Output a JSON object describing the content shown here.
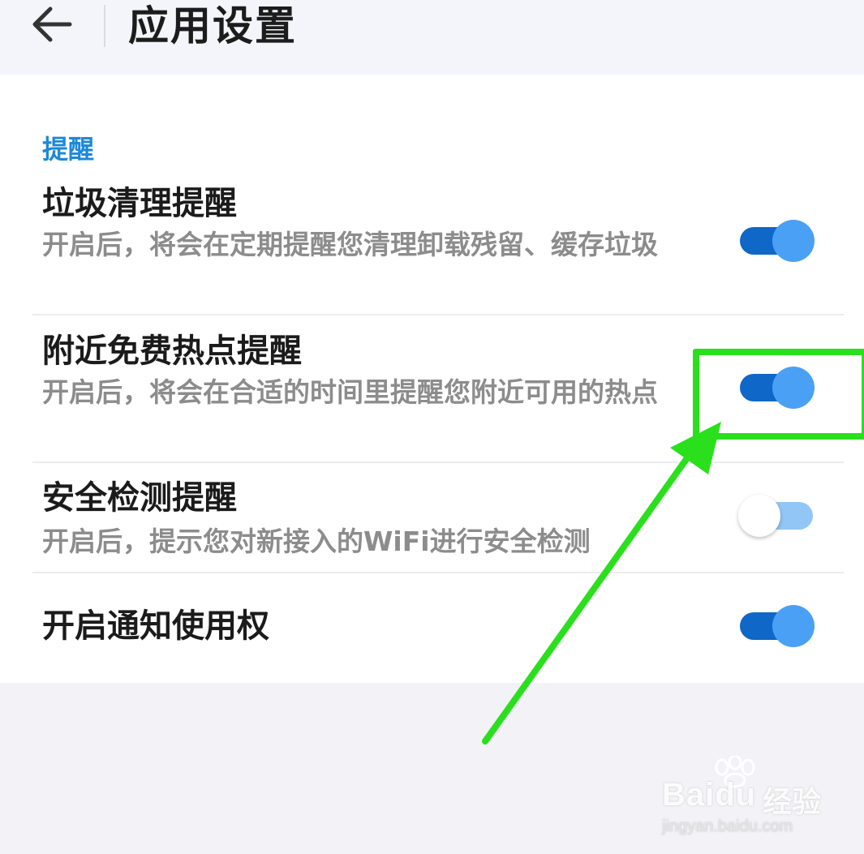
{
  "header": {
    "title": "应用设置"
  },
  "section": {
    "title": "提醒"
  },
  "settings": [
    {
      "title": "垃圾清理提醒",
      "description": "开启后，将会在定期提醒您清理卸载残留、缓存垃圾",
      "enabled": true
    },
    {
      "title": "附近免费热点提醒",
      "description": "开启后，将会在合适的时间里提醒您附近可用的热点",
      "enabled": true
    },
    {
      "title": "安全检测提醒",
      "description": "开启后，提示您对新接入的WiFi进行安全检测",
      "enabled": false
    },
    {
      "title": "开启通知使用权",
      "enabled": true
    }
  ],
  "colors": {
    "accent": "#1e88d8",
    "switch_track_on": "#0f67c7",
    "switch_knob_on": "#4aa0f4",
    "switch_track_off": "#92c6f6",
    "annotation": "#2ae01c"
  },
  "icons": {
    "back": "arrow-left-icon"
  },
  "watermark": {
    "brand": "Bai",
    "brand_tail": "du",
    "brand_cn": "经验",
    "url": "jingyan.baidu.com"
  }
}
